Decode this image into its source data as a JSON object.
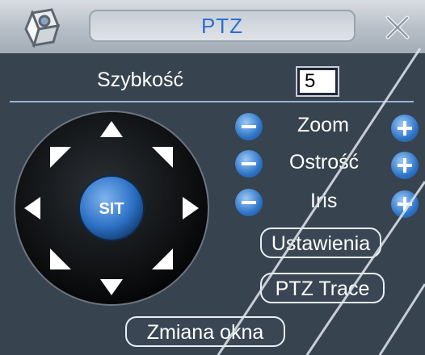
{
  "window": {
    "title": "PTZ"
  },
  "speed": {
    "label": "Szybkość",
    "value": "5"
  },
  "dpad": {
    "center_label": "SIT"
  },
  "controls": [
    {
      "label": "Zoom"
    },
    {
      "label": "Ostrość"
    },
    {
      "label": "Iris"
    }
  ],
  "buttons": {
    "settings": "Ustawienia",
    "trace": "PTZ Trace",
    "change_window": "Zmiana okna"
  },
  "colors": {
    "title": "#2d6fd1",
    "panel": "#37434f",
    "accent_button": "#2e75c8"
  }
}
